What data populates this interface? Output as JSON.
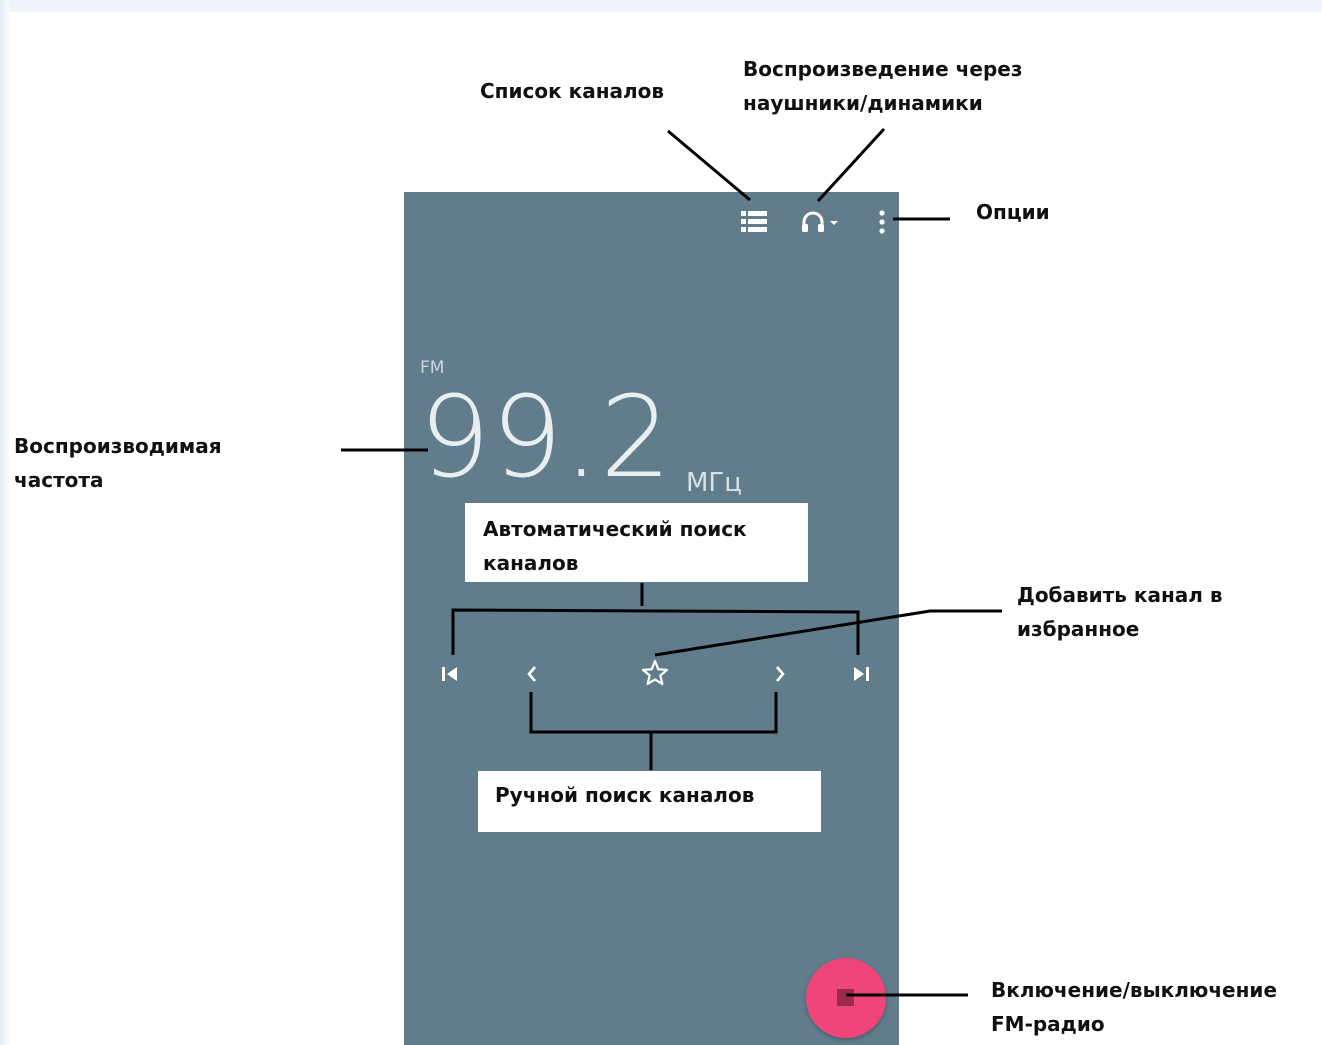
{
  "radio": {
    "band": "FM",
    "frequency": "99.2",
    "unit": "МГц"
  },
  "icons": {
    "channel_list": "list-icon",
    "audio_output": "headphones-icon",
    "options": "more-vert-icon",
    "seek_prev": "skip-previous-icon",
    "tune_down": "chevron-left-icon",
    "favorite": "star-outline-icon",
    "tune_up": "chevron-right-icon",
    "seek_next": "skip-next-icon",
    "power": "stop-icon"
  },
  "colors": {
    "screen_bg": "#617d8b",
    "fab": "#f0457a",
    "fab_icon": "#9b2a4e"
  },
  "callouts": {
    "channel_list": "Список каналов",
    "audio_output_line1": "Воспроизведение через",
    "audio_output_line2": "наушники/динамики",
    "options": "Опции",
    "frequency_line1": "Воспроизводимая",
    "frequency_line2": "частота",
    "auto_search_line1": "Автоматический поиск",
    "auto_search_line2": "каналов",
    "favorite_line1": "Добавить канал в",
    "favorite_line2": "избранное",
    "manual_search": "Ручной поиск каналов",
    "power_line1": "Включение/выключение",
    "power_line2": "FM-радио"
  }
}
